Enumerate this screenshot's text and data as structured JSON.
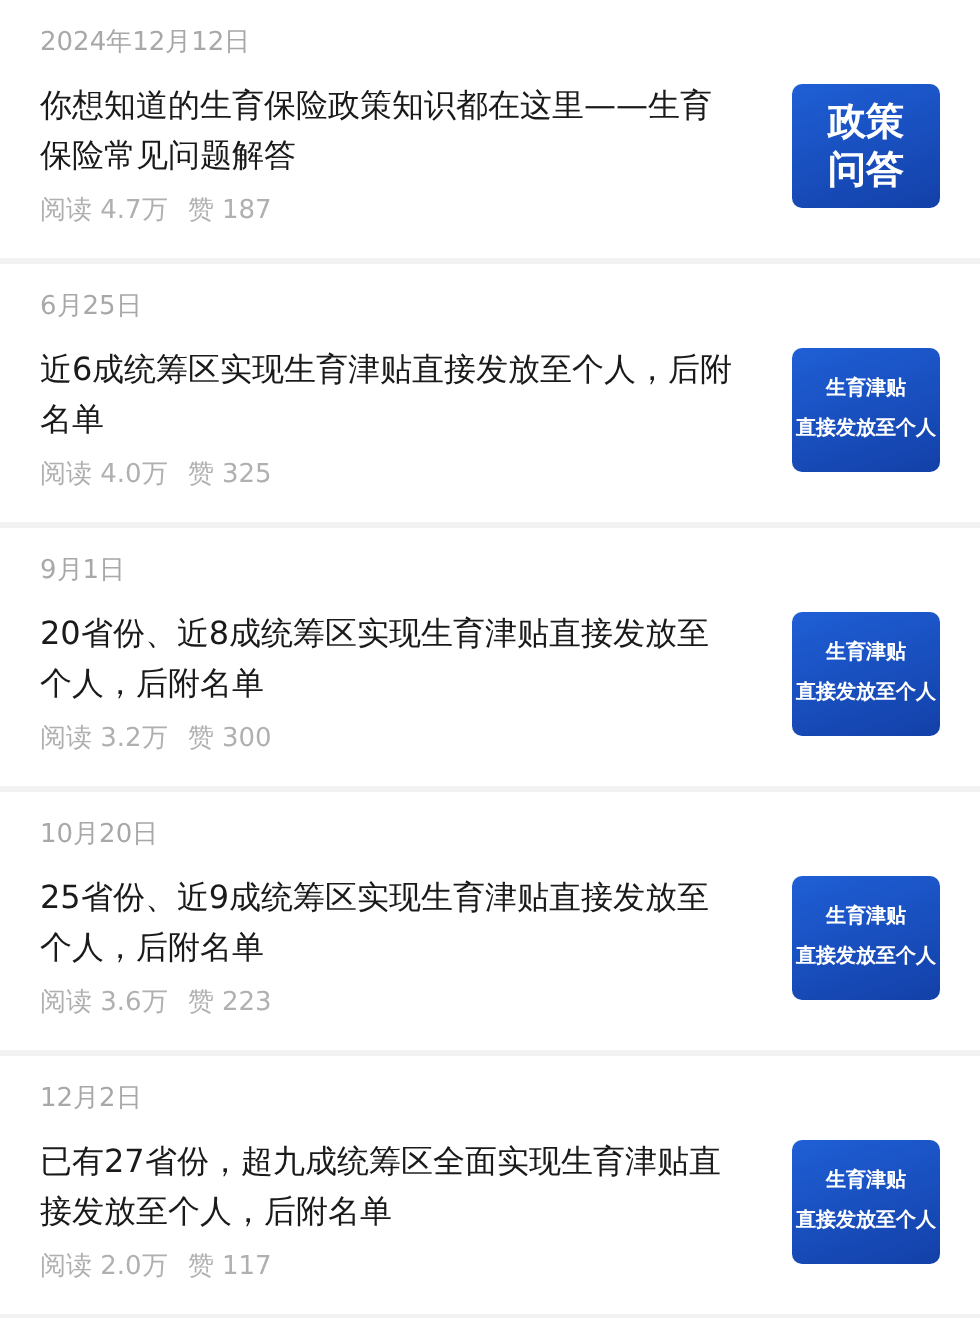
{
  "articles": [
    {
      "date": "2024年12月12日",
      "title": "你想知道的生育保险政策知识都在这里——生育保险常见问题解答",
      "reads": "阅读 4.7万",
      "likes": "赞 187",
      "thumbnail": {
        "kind": "large",
        "lines": [
          "政策",
          "问答"
        ]
      }
    },
    {
      "date": "6月25日",
      "title": "近6成统筹区实现生育津贴直接发放至个人，后附名单",
      "reads": "阅读 4.0万",
      "likes": "赞 325",
      "thumbnail": {
        "kind": "small",
        "lines": [
          "生育津贴",
          "直接发放至个人"
        ]
      }
    },
    {
      "date": "9月1日",
      "title": "20省份、近8成统筹区实现生育津贴直接发放至个人，后附名单",
      "reads": "阅读 3.2万",
      "likes": "赞 300",
      "thumbnail": {
        "kind": "small",
        "lines": [
          "生育津贴",
          "直接发放至个人"
        ]
      }
    },
    {
      "date": "10月20日",
      "title": "25省份、近9成统筹区实现生育津贴直接发放至个人，后附名单",
      "reads": "阅读 3.6万",
      "likes": "赞 223",
      "thumbnail": {
        "kind": "small",
        "lines": [
          "生育津贴",
          "直接发放至个人"
        ]
      }
    },
    {
      "date": "12月2日",
      "title": "已有27省份，超九成统筹区全面实现生育津贴直接发放至个人，后附名单",
      "reads": "阅读 2.0万",
      "likes": "赞 117",
      "thumbnail": {
        "kind": "small",
        "lines": [
          "生育津贴",
          "直接发放至个人"
        ]
      }
    }
  ]
}
